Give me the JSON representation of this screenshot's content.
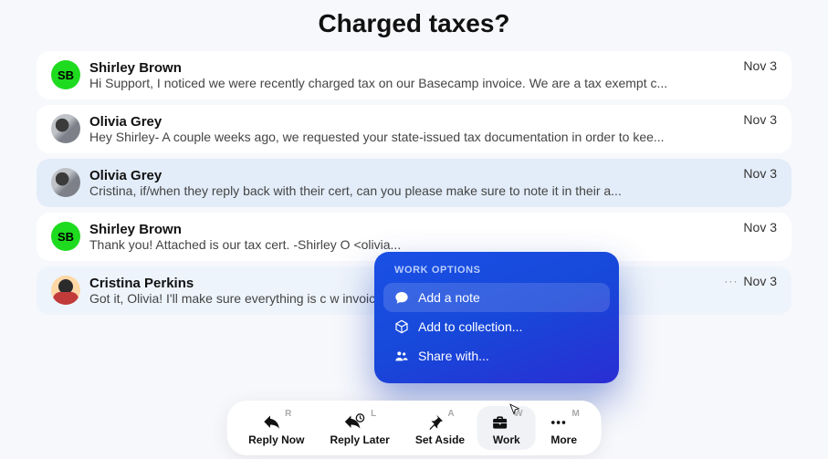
{
  "title": "Charged taxes?",
  "messages": [
    {
      "sender": "Shirley Brown",
      "avatar": "sb",
      "initials": "SB",
      "preview": "Hi Support, I noticed we were recently charged tax on our Basecamp invoice. We are a tax exempt c...",
      "date": "Nov 3",
      "style": "plain"
    },
    {
      "sender": "Olivia Grey",
      "avatar": "og",
      "initials": "",
      "preview": "Hey Shirley- A couple weeks ago, we requested your state-issued tax documentation in order to kee...",
      "date": "Nov 3",
      "style": "plain"
    },
    {
      "sender": "Olivia Grey",
      "avatar": "og",
      "initials": "",
      "preview": "Cristina, if/when they reply back with their cert, can you please make sure to note it in their a...",
      "date": "Nov 3",
      "style": "highlight"
    },
    {
      "sender": "Shirley Brown",
      "avatar": "sb",
      "initials": "SB",
      "preview": "Thank you! Attached is our tax cert. -Shirley O                                                <olivia...",
      "date": "Nov 3",
      "style": "plain"
    },
    {
      "sender": "Cristina Perkins",
      "avatar": "cp",
      "initials": "",
      "preview": "Got it, Olivia! I'll make sure everything is c                                              w invoice.",
      "date": "Nov 3",
      "style": "active",
      "show_dots": true
    }
  ],
  "popup": {
    "header": "WORK OPTIONS",
    "items": [
      {
        "icon": "chat-bubble-icon",
        "label": "Add a note",
        "selected": true
      },
      {
        "icon": "cube-icon",
        "label": "Add to collection...",
        "selected": false
      },
      {
        "icon": "people-icon",
        "label": "Share with...",
        "selected": false
      }
    ]
  },
  "toolbar": [
    {
      "icon": "reply-icon",
      "label": "Reply Now",
      "key": "R",
      "active": false
    },
    {
      "icon": "reply-clock-icon",
      "label": "Reply Later",
      "key": "L",
      "active": false
    },
    {
      "icon": "pin-icon",
      "label": "Set Aside",
      "key": "A",
      "active": false
    },
    {
      "icon": "briefcase-icon",
      "label": "Work",
      "key": "W",
      "active": true
    },
    {
      "icon": "dots-icon",
      "label": "More",
      "key": "M",
      "active": false
    }
  ]
}
